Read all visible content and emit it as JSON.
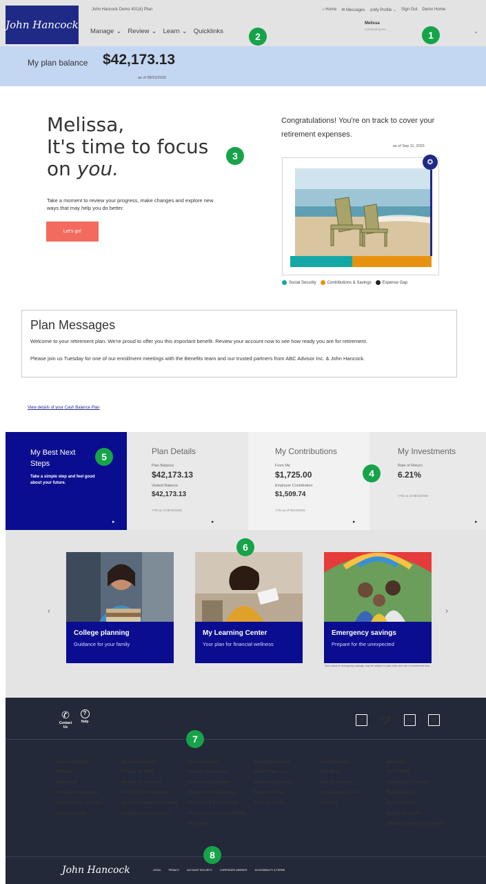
{
  "header": {
    "logo_text": "John Hancock",
    "plan_name": "John Hancock Demo 401(k) Plan",
    "nav": [
      "Manage",
      "Review",
      "Learn",
      "Quicklinks"
    ],
    "util": [
      "Home",
      "Messages",
      "My Profile",
      "Sign Out",
      "Demo Home"
    ],
    "user_name": "Melissa",
    "user_sub": "contributing 5% _ _"
  },
  "balance": {
    "label": "My plan balance",
    "amount": "$42,173.13",
    "as_of": "as of 08/10/2025"
  },
  "hero": {
    "title_line1": "Melissa,",
    "title_line2": "It's time to focus",
    "title_line3a": "on ",
    "title_line3b": "you.",
    "subtitle": "Take a moment to review your progress, make changes and explore new ways that may help you do better.",
    "cta": "Let's go!",
    "congrats": "Congratulations! You're on track to cover your retirement expenses.",
    "as_of": "as of Sep 11, 2025",
    "legend": [
      {
        "label": "Social Security",
        "color": "#13a8a5"
      },
      {
        "label": "Contributions & Savings",
        "color": "#e8930f"
      },
      {
        "label": "Expense Gap",
        "color": "#222222"
      }
    ],
    "income_split": {
      "social_security": 0.44,
      "contributions_savings": 0.56
    }
  },
  "messages": {
    "title": "Plan Messages",
    "line1": "Welcome to your retirement plan. We're proud to offer you this important benefit. Review your account now to see how ready you are for retirement.",
    "line2": "Please join us Tuesday for one of our enrollment meetings with the Benefits team and our trusted partners from ABC Advisor Inc. & John Hancock.",
    "cash_link": "View details of your Cash Balance Plan"
  },
  "tiles": {
    "best": {
      "title": "My Best Next Steps",
      "sub": "Take a simple step and feel good about your future."
    },
    "plan": {
      "title": "Plan Details",
      "l1": "Plan Balance",
      "v1": "$42,173.13",
      "l2": "Vested Balance",
      "v2": "$42,173.13",
      "ytd": "YTD as of 08/10/2025"
    },
    "contrib": {
      "title": "My Contributions",
      "l1": "From Me",
      "v1": "$1,725.00",
      "l2": "Employer Contribution",
      "v2": "$1,509.74",
      "ytd": "YTD as of 08/10/2025"
    },
    "invest": {
      "title": "My Investments",
      "l1": "Rate of Return",
      "v1": "6.21%",
      "ytd": "YTD as of 08/10/2025"
    }
  },
  "cards": [
    {
      "title": "College planning",
      "sub": "Guidance for your family"
    },
    {
      "title": "My Learning Center",
      "sub": "Your plan for financial wellness"
    },
    {
      "title": "Emergency savings",
      "sub": "Prepare for the unexpected"
    }
  ],
  "card_disclaimer": "Not a bank or emergency savings; may be subject to plan rules and risk of investment loss.",
  "footer": {
    "contact": "Contact Us",
    "help": "Help",
    "columns": [
      {
        "h": "How Am I Doing?",
        "items": [
          "My Goal",
          "Statements",
          "My Account Overview",
          "Personal Rate of Return",
          "Activity History"
        ]
      },
      {
        "h": "My Contributions",
        "items": [
          "Change My Rate",
          "Manage My Increase",
          "View YTD Contributions",
          "View Contribution Calculator",
          "Combining My Accounts"
        ]
      },
      {
        "h": "My Investments",
        "items": [
          "View My Investments",
          "Investment Strategies",
          "Change My Investments",
          "View Fees & Performance",
          "View Historical Prices (NAVs)",
          "Get Advice"
        ]
      },
      {
        "h": "Taking Money Out",
        "items": [
          "Model a New Loan",
          "Outstanding Loans",
          "Request Forms",
          "View Tax Forms"
        ]
      },
      {
        "h": "About the Plan",
        "items": [
          "Plan Home",
          "Plan Documents",
          "My Learning Center",
          "Glossary"
        ]
      },
      {
        "h": "About Me",
        "items": [
          "View Profile",
          "Change My Password",
          "My Beneficiary",
          "My Contact Info",
          "Update Bank Info",
          "Update Statement Preference"
        ]
      }
    ],
    "logo_text": "John Hancock",
    "links": [
      "LEGAL",
      "PRIVACY",
      "ACCOUNT SECURITY",
      "CORPORATE WEBSITE",
      "ACCESSIBILITY & TERMS"
    ]
  },
  "badges": [
    "1",
    "2",
    "3",
    "4",
    "5",
    "6",
    "7",
    "8"
  ]
}
